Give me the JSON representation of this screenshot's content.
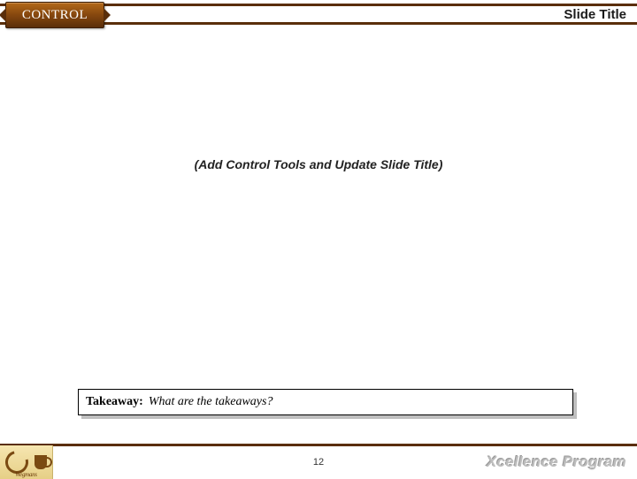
{
  "header": {
    "tab_label": "CONTROL",
    "slide_title": "Slide Title"
  },
  "body": {
    "instruction": "(Add Control Tools and Update Slide Title)"
  },
  "takeaway": {
    "label": "Takeaway:",
    "text": "What are the takeaways?"
  },
  "footer": {
    "logo_name": "Wegmans",
    "page_number": "12",
    "program_name": "Xcellence Program"
  }
}
